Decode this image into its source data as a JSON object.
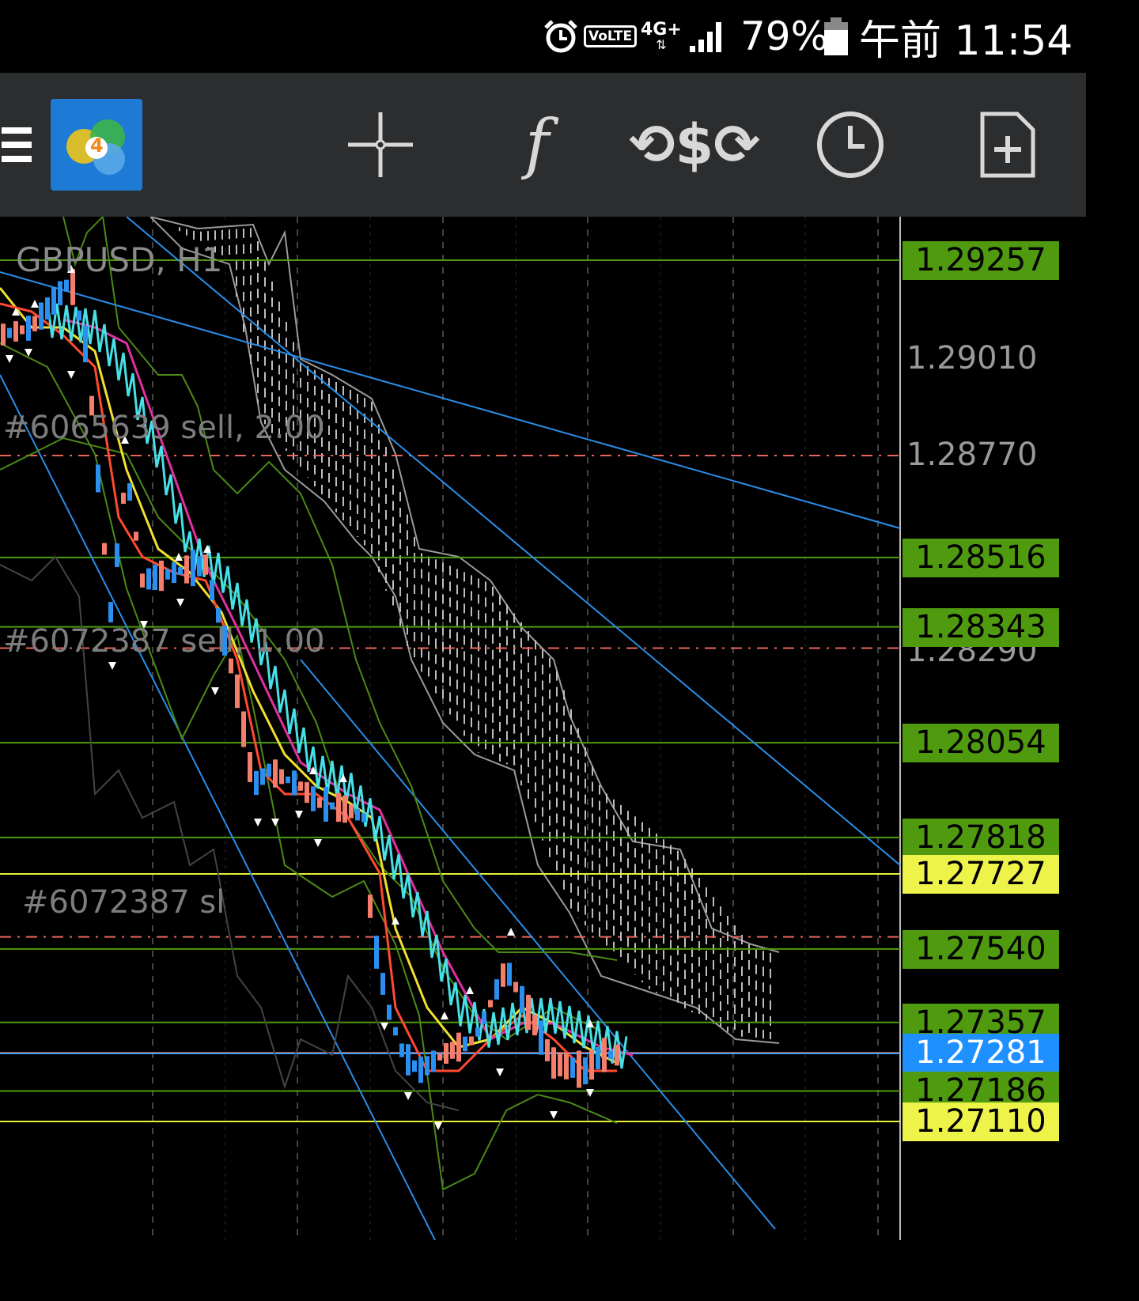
{
  "status_bar": {
    "network": "4G+",
    "volte": "VoLTE",
    "battery": "79%",
    "time": "午前 11:54"
  },
  "toolbar": {
    "menu_icon": "hamburger-menu-icon",
    "app_logo_badge": "4",
    "icons": [
      "crosshair-icon",
      "function-icon",
      "trade-icon",
      "clock-icon",
      "new-document-icon"
    ]
  },
  "chart": {
    "symbol_label": "GBPUSD, H1",
    "axis_prices": [
      "1.29010",
      "1.28770",
      "1.28290"
    ],
    "orders": [
      {
        "label": "#6065639 sell, 2.00",
        "price": "1.28770"
      },
      {
        "label": "#6072387 sell, 1.00",
        "price": "1.28290"
      },
      {
        "label": "#6072387 sl",
        "price": "1.27570"
      }
    ],
    "price_tags": [
      {
        "value": "1.29257",
        "style": "green"
      },
      {
        "value": "1.28516",
        "style": "green"
      },
      {
        "value": "1.28343",
        "style": "green"
      },
      {
        "value": "1.28054",
        "style": "green"
      },
      {
        "value": "1.27818",
        "style": "green"
      },
      {
        "value": "1.27727",
        "style": "yellow"
      },
      {
        "value": "1.27540",
        "style": "green"
      },
      {
        "value": "1.27357",
        "style": "green"
      },
      {
        "value": "1.27281",
        "style": "blue"
      },
      {
        "value": "1.27186",
        "style": "green"
      },
      {
        "value": "1.27110",
        "style": "yellow"
      }
    ],
    "colors": {
      "green_tag": "#4f9a0e",
      "yellow_tag": "#eef34a",
      "blue_tag": "#1e90ff",
      "bull_candle": "#f47d6c",
      "bear_candle": "#2b8ff0",
      "band": "#46e0e6",
      "ichimoku_cloud": "#9a9a9a"
    }
  }
}
